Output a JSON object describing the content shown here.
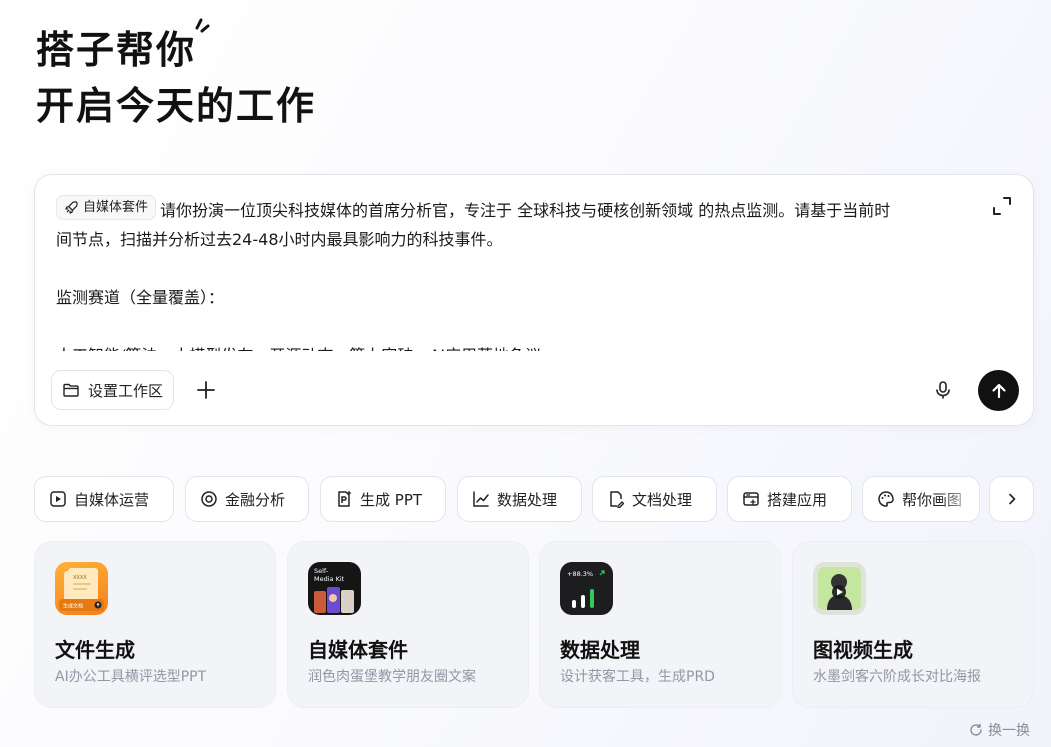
{
  "hero": {
    "line1": "搭子帮你",
    "line2": "开启今天的工作"
  },
  "composer": {
    "tag_label": "自媒体套件",
    "line1": "请你扮演一位顶尖科技媒体的首席分析官，专注于 全球科技与硬核创新领域 的热点监测。请基于当前时",
    "line2": "间节点，扫描并分析过去24-48小时内最具影响力的科技事件。",
    "line3": "监测赛道（全量覆盖）：",
    "line4": "人工智能/算法：大模型发布、开源动态、算力突破、AI应用落地争议",
    "workspace_label": "设置工作区"
  },
  "chips": [
    {
      "label": "自媒体运营",
      "icon": "video-play-icon"
    },
    {
      "label": "金融分析",
      "icon": "target-icon"
    },
    {
      "label": "生成 PPT",
      "icon": "ppt-icon"
    },
    {
      "label": "数据处理",
      "icon": "line-chart-icon"
    },
    {
      "label": "文档处理",
      "icon": "doc-edit-icon"
    },
    {
      "label": "搭建应用",
      "icon": "app-window-icon"
    },
    {
      "label": "帮你画图",
      "icon": "palette-icon"
    }
  ],
  "cards": [
    {
      "title": "文件生成",
      "subtitle": "AI办公工具横评选型PPT",
      "icon_text": "生成文档",
      "icon_heading": "XXXX"
    },
    {
      "title": "自媒体套件",
      "subtitle": "润色肉蛋堡教学朋友圈文案",
      "icon_text_1": "Self-",
      "icon_text_2": "Media Kit"
    },
    {
      "title": "数据处理",
      "subtitle": "设计获客工具，生成PRD",
      "icon_text": "+88.3%"
    },
    {
      "title": "图视频生成",
      "subtitle": "水墨剑客六阶成长对比海报"
    }
  ],
  "refresh_label": "换一换",
  "colors": {
    "send_button": "#111111",
    "card_bg": "#f3f4f8",
    "subtitle": "#9297a3",
    "accent_orange": "#f5a623",
    "accent_green": "#34c759"
  }
}
